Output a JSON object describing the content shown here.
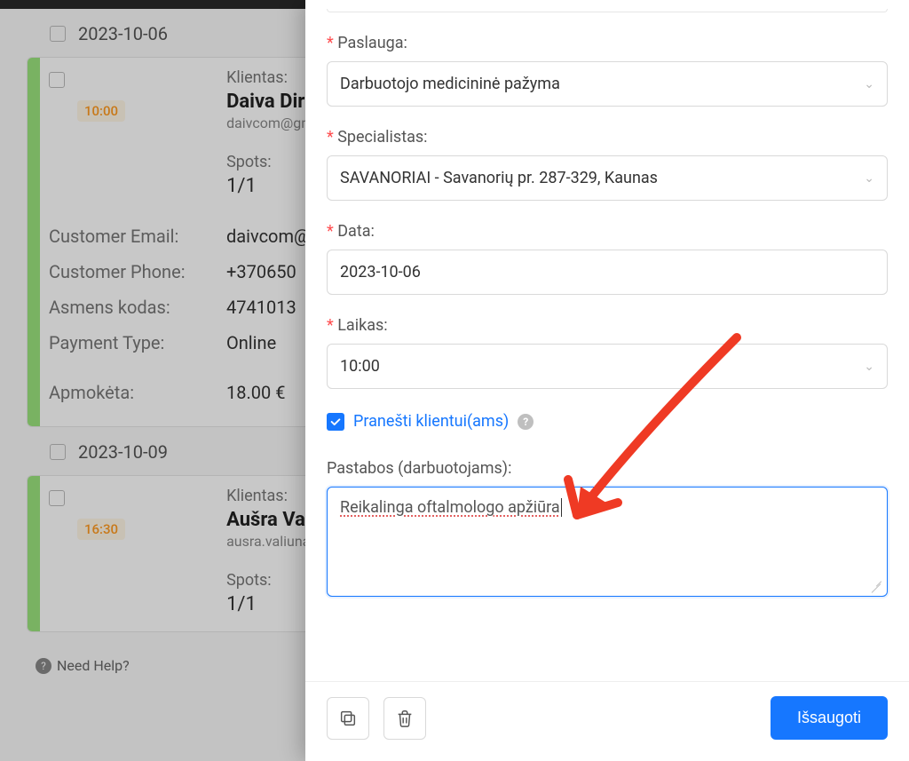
{
  "bg": {
    "date1": "2023-10-06",
    "date2": "2023-10-09",
    "client_label": "Klientas:",
    "spots_label": "Spots:",
    "card1": {
      "time": "10:00",
      "name": "Daiva Dirme",
      "email": "daivcom@gmail",
      "spots": "1/1",
      "details": [
        {
          "k": "Customer Email:",
          "v": "daivcom@"
        },
        {
          "k": "Customer Phone:",
          "v": "+370650"
        },
        {
          "k": "Asmens kodas:",
          "v": "4741013"
        },
        {
          "k": "Payment Type:",
          "v": "Online"
        },
        {
          "k": "Apmokėta:",
          "v": "18.00 €"
        }
      ]
    },
    "card2": {
      "time": "16:30",
      "name": "Aušra Valiūn",
      "email": "ausra.valiunaite",
      "spots": "1/1"
    },
    "help": "Need Help?"
  },
  "form": {
    "paslauga_label": "Paslauga:",
    "paslauga_value": "Darbuotojo medicininė pažyma",
    "specialistas_label": "Specialistas:",
    "specialistas_value": "SAVANORIAI - Savanorių pr. 287-329, Kaunas",
    "data_label": "Data:",
    "data_value": "2023-10-06",
    "laikas_label": "Laikas:",
    "laikas_value": "10:00",
    "notify_label": "Pranešti klientui(ams)",
    "notes_label": "Pastabos (darbuotojams):",
    "notes_value": "Reikalinga oftalmologo apžiūra",
    "save_label": "Išsaugoti"
  }
}
